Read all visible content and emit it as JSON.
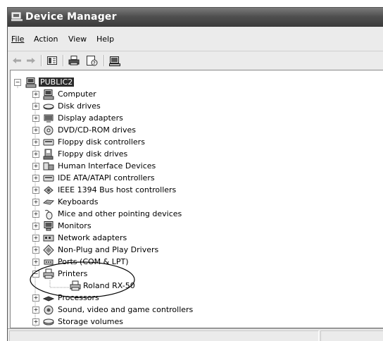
{
  "window": {
    "title": "Device Manager"
  },
  "menu": {
    "file": "File",
    "action": "Action",
    "view": "View",
    "help": "Help"
  },
  "toolbar": {
    "buttons": [
      "back-icon",
      "forward-icon",
      "properties-pane-icon",
      "print-icon",
      "help-icon",
      "computer-icon"
    ]
  },
  "tree": {
    "root": "PUBLIC2",
    "items": [
      {
        "label": "Computer",
        "icon": "computer-icon"
      },
      {
        "label": "Disk drives",
        "icon": "disk-drive-icon"
      },
      {
        "label": "Display adapters",
        "icon": "display-adapter-icon"
      },
      {
        "label": "DVD/CD-ROM drives",
        "icon": "dvd-drive-icon"
      },
      {
        "label": "Floppy disk controllers",
        "icon": "controller-icon"
      },
      {
        "label": "Floppy disk drives",
        "icon": "floppy-icon"
      },
      {
        "label": "Human Interface Devices",
        "icon": "hid-icon"
      },
      {
        "label": "IDE ATA/ATAPI controllers",
        "icon": "controller-icon"
      },
      {
        "label": "IEEE 1394 Bus host controllers",
        "icon": "ieee1394-icon"
      },
      {
        "label": "Keyboards",
        "icon": "keyboard-icon"
      },
      {
        "label": "Mice and other pointing devices",
        "icon": "mouse-icon"
      },
      {
        "label": "Monitors",
        "icon": "monitor-icon"
      },
      {
        "label": "Network adapters",
        "icon": "network-adapter-icon"
      },
      {
        "label": "Non-Plug and Play Drivers",
        "icon": "diamond-icon"
      },
      {
        "label": "Ports (COM & LPT)",
        "icon": "port-icon"
      },
      {
        "label": "Printers",
        "icon": "printer-icon"
      },
      {
        "label": "Roland RX-50",
        "icon": "printer-icon"
      },
      {
        "label": "Processors",
        "icon": "processor-icon"
      },
      {
        "label": "Sound, video and game controllers",
        "icon": "sound-icon"
      },
      {
        "label": "Storage volumes",
        "icon": "storage-icon"
      }
    ]
  },
  "annotation": {
    "shape": "ellipse",
    "target": "Printers",
    "color": "#000000"
  }
}
